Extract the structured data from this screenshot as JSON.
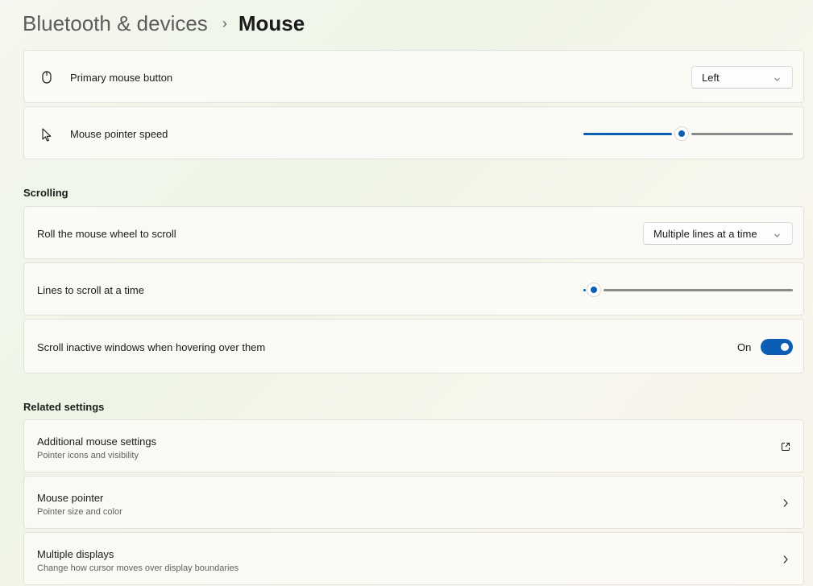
{
  "breadcrumb": {
    "parent": "Bluetooth & devices",
    "separator": "›",
    "current": "Mouse"
  },
  "settings": {
    "primary_button": {
      "label": "Primary mouse button",
      "icon": "mouse-icon",
      "value": "Left"
    },
    "pointer_speed": {
      "label": "Mouse pointer speed",
      "icon": "cursor-arrow-icon",
      "level": 0.47
    }
  },
  "scrolling": {
    "title": "Scrolling",
    "roll_wheel": {
      "label": "Roll the mouse wheel to scroll",
      "value": "Multiple lines at a time"
    },
    "lines_at_a_time": {
      "label": "Lines to scroll at a time",
      "level": 0.05
    },
    "inactive_windows": {
      "label": "Scroll inactive windows when hovering over them",
      "state_text": "On",
      "enabled": true
    }
  },
  "related": {
    "title": "Related settings",
    "items": [
      {
        "title": "Additional mouse settings",
        "subtitle": "Pointer icons and visibility",
        "icon": "open-external-icon"
      },
      {
        "title": "Mouse pointer",
        "subtitle": "Pointer size and color",
        "icon": "chevron-right-icon"
      },
      {
        "title": "Multiple displays",
        "subtitle": "Change how cursor moves over display boundaries",
        "icon": "chevron-right-icon"
      }
    ]
  },
  "colors": {
    "accent": "#0a5fb4",
    "track_inactive": "#8a8a8a"
  }
}
